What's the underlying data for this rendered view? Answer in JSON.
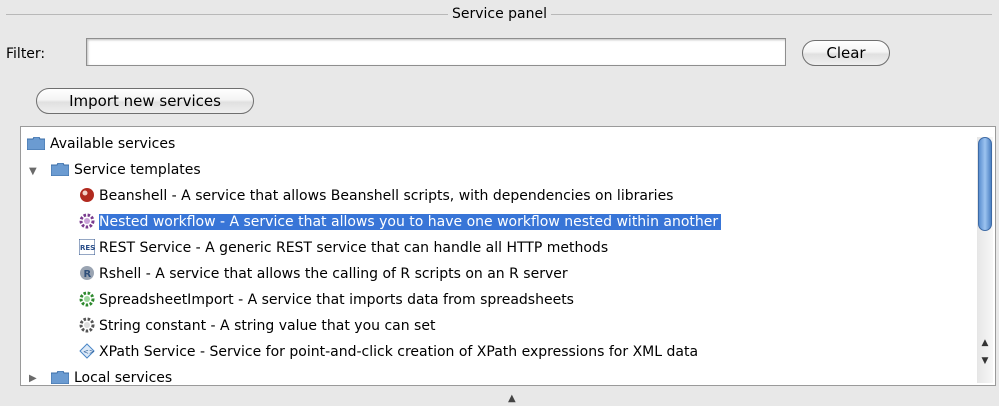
{
  "panel": {
    "title": "Service panel"
  },
  "filter": {
    "label": "Filter:",
    "value": "",
    "placeholder": ""
  },
  "buttons": {
    "clear": "Clear",
    "import": "Import new services"
  },
  "tree": {
    "root": "Available services",
    "templates_folder": "Service templates",
    "items": [
      {
        "label": "Beanshell - A service that allows Beanshell scripts, with dependencies on libraries",
        "icon": "beanshell-icon",
        "selected": false
      },
      {
        "label": "Nested workflow - A service that allows you to have one workflow nested within another",
        "icon": "nested-workflow-icon",
        "selected": true
      },
      {
        "label": "REST Service - A generic REST service that can handle all HTTP methods",
        "icon": "rest-icon",
        "selected": false
      },
      {
        "label": "Rshell - A service that allows the calling of R scripts on an R server",
        "icon": "rshell-icon",
        "selected": false
      },
      {
        "label": "SpreadsheetImport - A service that imports data from spreadsheets",
        "icon": "spreadsheet-import-icon",
        "selected": false
      },
      {
        "label": "String constant - A string value that you can set",
        "icon": "string-constant-icon",
        "selected": false
      },
      {
        "label": "XPath Service - Service for point-and-click creation of XPath expressions for XML data",
        "icon": "xpath-icon",
        "selected": false
      }
    ],
    "local_folder": "Local services"
  },
  "colors": {
    "selection": "#3875d7",
    "folder": "#5a8fc8"
  }
}
